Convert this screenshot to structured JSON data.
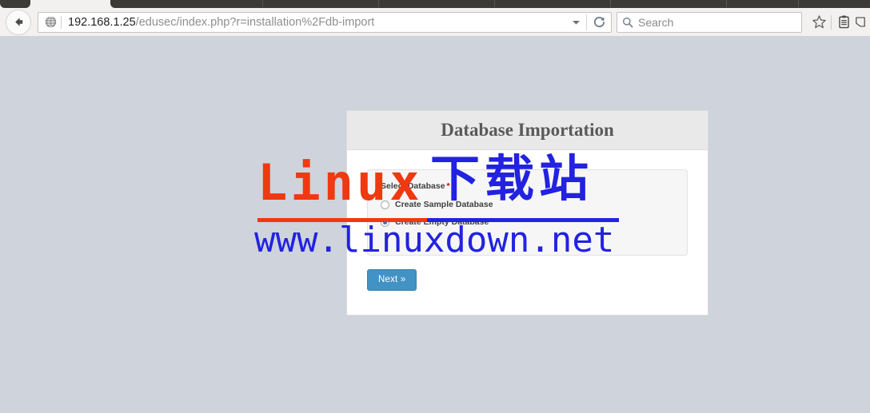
{
  "browser": {
    "tabs": [
      {
        "id": "tab-1"
      },
      {
        "id": "tab-2"
      }
    ],
    "back_button_icon": "back-arrow-icon",
    "identity_icon": "globe-icon",
    "url": {
      "host": "192.168.1.25",
      "path": "/edusec/index.php?r=installation%2Fdb-import",
      "full": "192.168.1.25/edusec/index.php?r=installation%2Fdb-import"
    },
    "url_dropdown_icon": "chevron-down-icon",
    "reload_icon": "reload-icon",
    "search": {
      "placeholder": "Search",
      "icon": "search-icon",
      "value": ""
    },
    "toolbar_icons": [
      {
        "name": "bookmark-star-icon"
      },
      {
        "name": "reading-list-icon"
      },
      {
        "name": "sidebar-icon"
      }
    ]
  },
  "page": {
    "background_color": "#ced3dc",
    "card": {
      "title": "Database Importation",
      "header_bg": "#e9e9e9",
      "body_bg": "#ffffff"
    },
    "form": {
      "fieldset_label": "Select Database",
      "required_marker": "*",
      "required_color": "#cc0000",
      "options": [
        {
          "label": "Create Sample Database",
          "checked": false
        },
        {
          "label": "Create Empty Database",
          "checked": true
        }
      ],
      "submit_label": "Next »",
      "submit_color": "#4292c4"
    }
  },
  "watermark": {
    "brand_latin": "Linux",
    "brand_cjk": "下载站",
    "site_url": "www.linuxdown.net",
    "red_color": "#f03811",
    "blue_color": "#2222e0"
  }
}
